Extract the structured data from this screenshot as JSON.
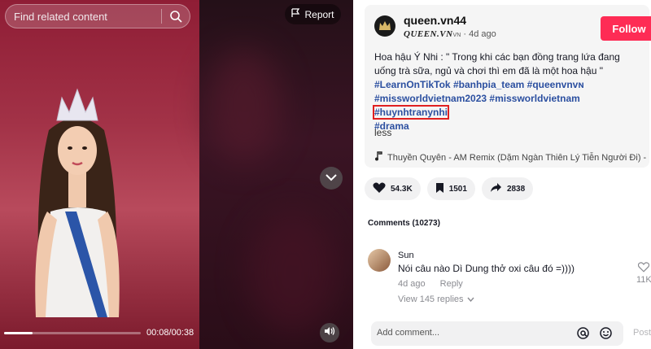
{
  "video": {
    "search_placeholder": "Find related content",
    "report_label": "Report",
    "time": "00:08/00:38",
    "progress_fraction": 0.21
  },
  "post": {
    "username": "queen.vn44",
    "nickname": "QUEEN.VN",
    "nickname_suffix": "VN",
    "age": "4d ago",
    "follow_label": "Follow",
    "description": "Hoa hậu Ý Nhi : \" Trong khi các bạn đồng trang lứa đang uống trà sữa, ngủ và chơi thì em đã là một hoa hậu \"",
    "hashtags": [
      "#LearnOnTikTok",
      "#banhpia_team",
      "#queenvnᴠɴ",
      "#missworldvietnam2023",
      "#missworldvietnam",
      "#huynhtranynhi",
      "#drama"
    ],
    "less_label": "less",
    "music": "Thuyền Quyên - AM Remix (Dặm Ngàn Thiên Lý Tiễn Người Đi) -"
  },
  "actions": {
    "likes": "54.3K",
    "saves": "1501",
    "shares": "2838"
  },
  "comments": {
    "title": "Comments (10273)",
    "items": [
      {
        "name": "Sun",
        "text": "Nói câu nào Dì Dung thở oxi câu đó =))))",
        "age": "4d ago",
        "reply_label": "Reply",
        "views_label": "View 145 replies",
        "likes": "11K"
      }
    ],
    "input_placeholder": "Add comment...",
    "post_label": "Post"
  },
  "colors": {
    "accent": "#fe2c55",
    "hashtag": "#2b4fa0",
    "highlight_box": "#e02020"
  }
}
